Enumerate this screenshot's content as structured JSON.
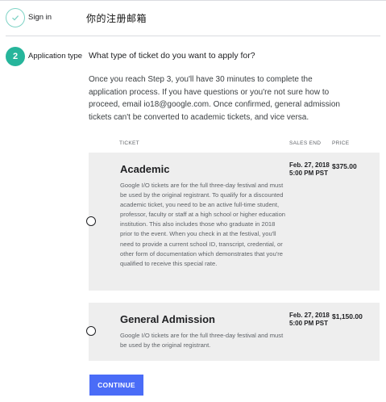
{
  "steps": [
    {
      "label": "Sign in",
      "state": "done"
    },
    {
      "number": "2",
      "label": "Application type",
      "state": "active"
    }
  ],
  "sign_in_value": "你的注册邮箱",
  "application": {
    "question": "What type of ticket do you want to apply for?",
    "intro": "Once you reach Step 3, you'll have 30 minutes to complete the application process. If you have questions or you're not sure how to proceed, email io18@google.com. Once confirmed, general admission tickets can't be converted to academic tickets, and vice versa."
  },
  "table_headers": {
    "ticket": "TICKET",
    "sales_end": "SALES END",
    "price": "PRICE"
  },
  "tickets": [
    {
      "name": "Academic",
      "description": "Google I/O tickets are for the full three-day festival and must be used by the original registrant. To qualify for a discounted academic ticket, you need to be an active full-time student, professor, faculty or staff at a high school or higher education institution. This also includes those who graduate in 2018 prior to the event. When you check in at the festival, you'll need to provide a current school ID, transcript, credential, or other form of documentation which demonstrates that you're qualified to receive this special rate.",
      "sales_end": "Feb. 27, 2018 5:00 PM PST",
      "price": "$375.00",
      "selected": false
    },
    {
      "name": "General Admission",
      "description": "Google I/O tickets are for the full three-day festival and must be used by the original registrant.",
      "sales_end": "Feb. 27, 2018 5:00 PM PST",
      "price": "$1,150.00",
      "selected": false
    }
  ],
  "continue_label": "CONTINUE",
  "colors": {
    "accent": "#26b59b",
    "button": "#4a6cf7",
    "card": "#eeeeee"
  }
}
